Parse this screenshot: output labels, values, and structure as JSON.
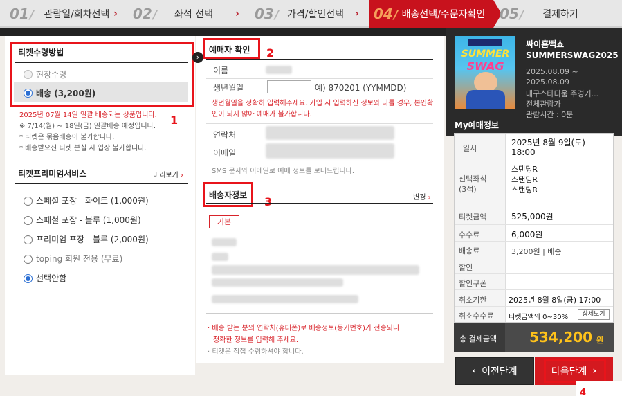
{
  "steps": [
    {
      "num": "01",
      "label": "관람일/회차선택"
    },
    {
      "num": "02",
      "label": "좌석 선택"
    },
    {
      "num": "03",
      "label": "가격/할인선택"
    },
    {
      "num": "04",
      "label": "배송선택/주문자확인"
    },
    {
      "num": "05",
      "label": "결제하기"
    }
  ],
  "ticket_receive": {
    "title": "티켓수령방법",
    "option1": "현장수령",
    "option2": "배송 (3,200원)",
    "notes": [
      "2025년 07월 14일 일괄 배송되는 상품입니다.",
      "※ 7/14(월) ~ 18일(금) 일괄배송 예정입니다.",
      "* 티켓은 묶음배송이 불가합니다.",
      "* 배송받으신 티켓 분실 시 입장 불가합니다."
    ]
  },
  "premium": {
    "title": "티켓프리미엄서비스",
    "preview": "미리보기",
    "options": [
      "스페셜 포장 - 화이트 (1,000원)",
      "스페셜 포장 - 블루 (1,000원)",
      "프리미엄 포장 - 블루 (2,000원)",
      "toping 회원 전용 (무료)",
      "선택안함"
    ]
  },
  "buyer": {
    "title": "예매자 확인",
    "name_label": "이름",
    "birth_label": "생년월일",
    "birth_hint": "예) 870201 (YYMMDD)",
    "warning": "생년월일을 정확히 입력해주세요. 가입 시 입력하신 정보와 다를 경우, 본인확인이 되지 않아 예매가 불가합니다.",
    "contact_label": "연락처",
    "email_label": "이메일",
    "sms_note": "SMS 문자와 이메일로 예매 정보를 보내드립니다."
  },
  "shipping": {
    "title": "배송자정보",
    "change": "변경",
    "badge": "기본",
    "notes": [
      "· 배송 받는 분의 연락처(휴대폰)로 배송정보(등기번호)가 전송되니",
      "정확한 정보를 입력해 주세요.",
      "· 티켓은 직접 수령하셔야 합니다."
    ]
  },
  "annotations": [
    "1",
    "2",
    "3",
    "4"
  ],
  "show": {
    "poster_line1": "SUMMER",
    "poster_line2": "SWAG",
    "title1": "싸이흠뻑쇼",
    "title2": "SUMMERSWAG2025",
    "date1": "2025.08.09 ~",
    "date2": "2025.08.09",
    "venue": "대구스타디움 주경기...",
    "rating": "전체관람가",
    "runtime": "관람시간 : 0분"
  },
  "my_booking": {
    "title": "My예매정보",
    "rows": [
      {
        "label": "일시",
        "value": "2025년 8월 9일(토)"
      },
      {
        "label": "",
        "value": "18:00"
      },
      {
        "label": "선택좌석",
        "value": "스탠딩R"
      },
      {
        "label": "(3석)",
        "value": "스탠딩R"
      },
      {
        "label": "",
        "value": "스탠딩R"
      },
      {
        "label": "티켓금액",
        "value": "525,000원"
      },
      {
        "label": "수수료",
        "value": "6,000원"
      },
      {
        "label": "배송료",
        "value": "3,200원 | 배송"
      },
      {
        "label": "할인",
        "value": ""
      },
      {
        "label": "할인쿠폰",
        "value": ""
      },
      {
        "label": "취소기한",
        "value": "2025년 8월 8일(금) 17:00"
      },
      {
        "label": "취소수수료",
        "value": "티켓금액의 0~30%"
      }
    ],
    "detail_btn": "상세보기",
    "total_label": "총 결제금액",
    "total_value": "534,200",
    "total_unit": "원"
  },
  "nav": {
    "prev": "이전단계",
    "next": "다음단계"
  },
  "colors": {
    "accent": "#c8121d",
    "annotation": "#e8141b",
    "radio": "#2b6fd3"
  }
}
